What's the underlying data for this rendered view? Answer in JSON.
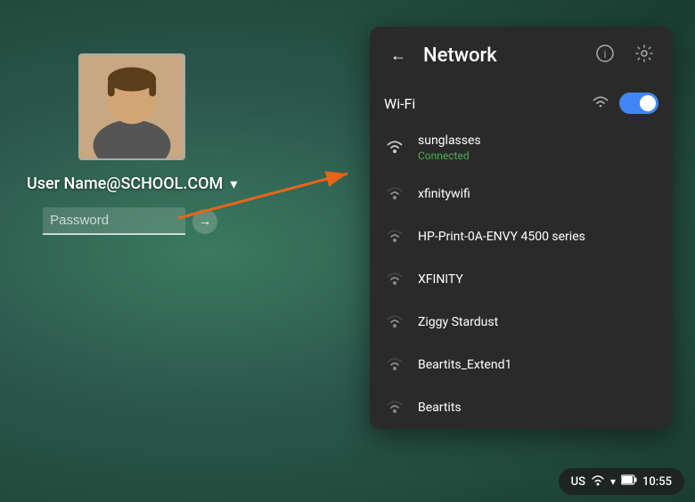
{
  "background": {
    "color": "#2d5a4e"
  },
  "login": {
    "username": "User Name@SCHOOL.COM",
    "password_placeholder": "Password",
    "chevron": "▾",
    "arrow_submit": "→"
  },
  "network_panel": {
    "title": "Network",
    "back_label": "←",
    "info_label": "ⓘ",
    "settings_label": "⚙",
    "wifi_section_label": "Wi-Fi",
    "wifi_toggle_on": true,
    "networks": [
      {
        "name": "sunglasses",
        "status": "Connected",
        "connected": true,
        "signal": 4
      },
      {
        "name": "xfinitywifi",
        "status": "",
        "connected": false,
        "signal": 3
      },
      {
        "name": "HP-Print-0A-ENVY 4500 series",
        "status": "",
        "connected": false,
        "signal": 2
      },
      {
        "name": "XFINITY",
        "status": "",
        "connected": false,
        "signal": 3
      },
      {
        "name": "Ziggy Stardust",
        "status": "",
        "connected": false,
        "signal": 3
      },
      {
        "name": "Beartits_Extend1",
        "status": "",
        "connected": false,
        "signal": 2
      },
      {
        "name": "Beartits",
        "status": "",
        "connected": false,
        "signal": 2
      }
    ]
  },
  "taskbar": {
    "locale": "US",
    "wifi_icon": "▾",
    "time": "10:55"
  },
  "icons": {
    "back": "←",
    "info": "ⓘ",
    "settings": "⚙",
    "chevron_down": "▾",
    "arrow_right": "→",
    "wifi_full": "WiFi"
  }
}
